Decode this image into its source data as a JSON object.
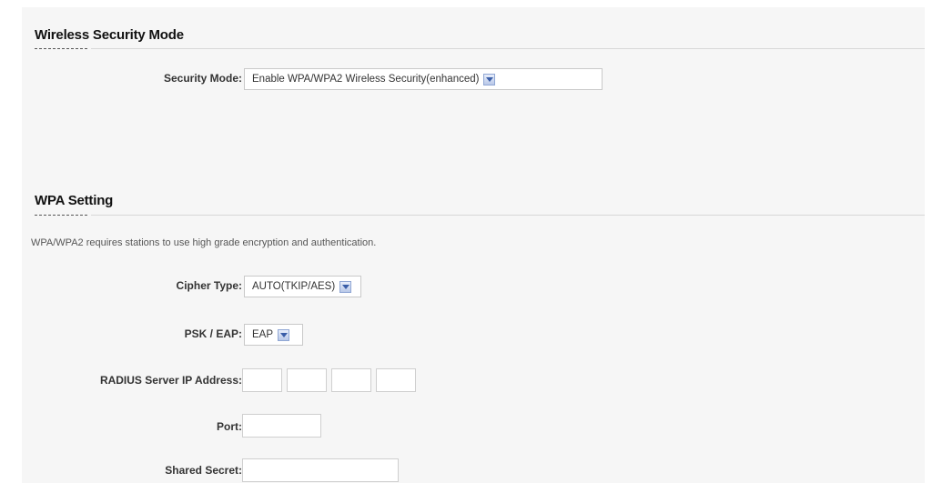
{
  "security_section": {
    "title": "Wireless Security Mode",
    "mode_label": "Security Mode:",
    "mode_value": "Enable WPA/WPA2 Wireless Security(enhanced)"
  },
  "wpa_section": {
    "title": "WPA Setting",
    "description": "WPA/WPA2 requires stations to use high grade encryption and authentication.",
    "cipher_label": "Cipher Type:",
    "cipher_value": "AUTO(TKIP/AES)",
    "psk_label": "PSK / EAP:",
    "psk_value": "EAP",
    "radius_label": "RADIUS Server IP Address:",
    "radius_octets": [
      "",
      "",
      "",
      ""
    ],
    "port_label": "Port:",
    "port_value": "",
    "secret_label": "Shared Secret:",
    "secret_value": ""
  },
  "colors": {
    "panel_background": "#f6f6f6",
    "select_arrow": "#3a5ea8"
  },
  "icons": {
    "dropdown": "chevron-down-icon"
  }
}
